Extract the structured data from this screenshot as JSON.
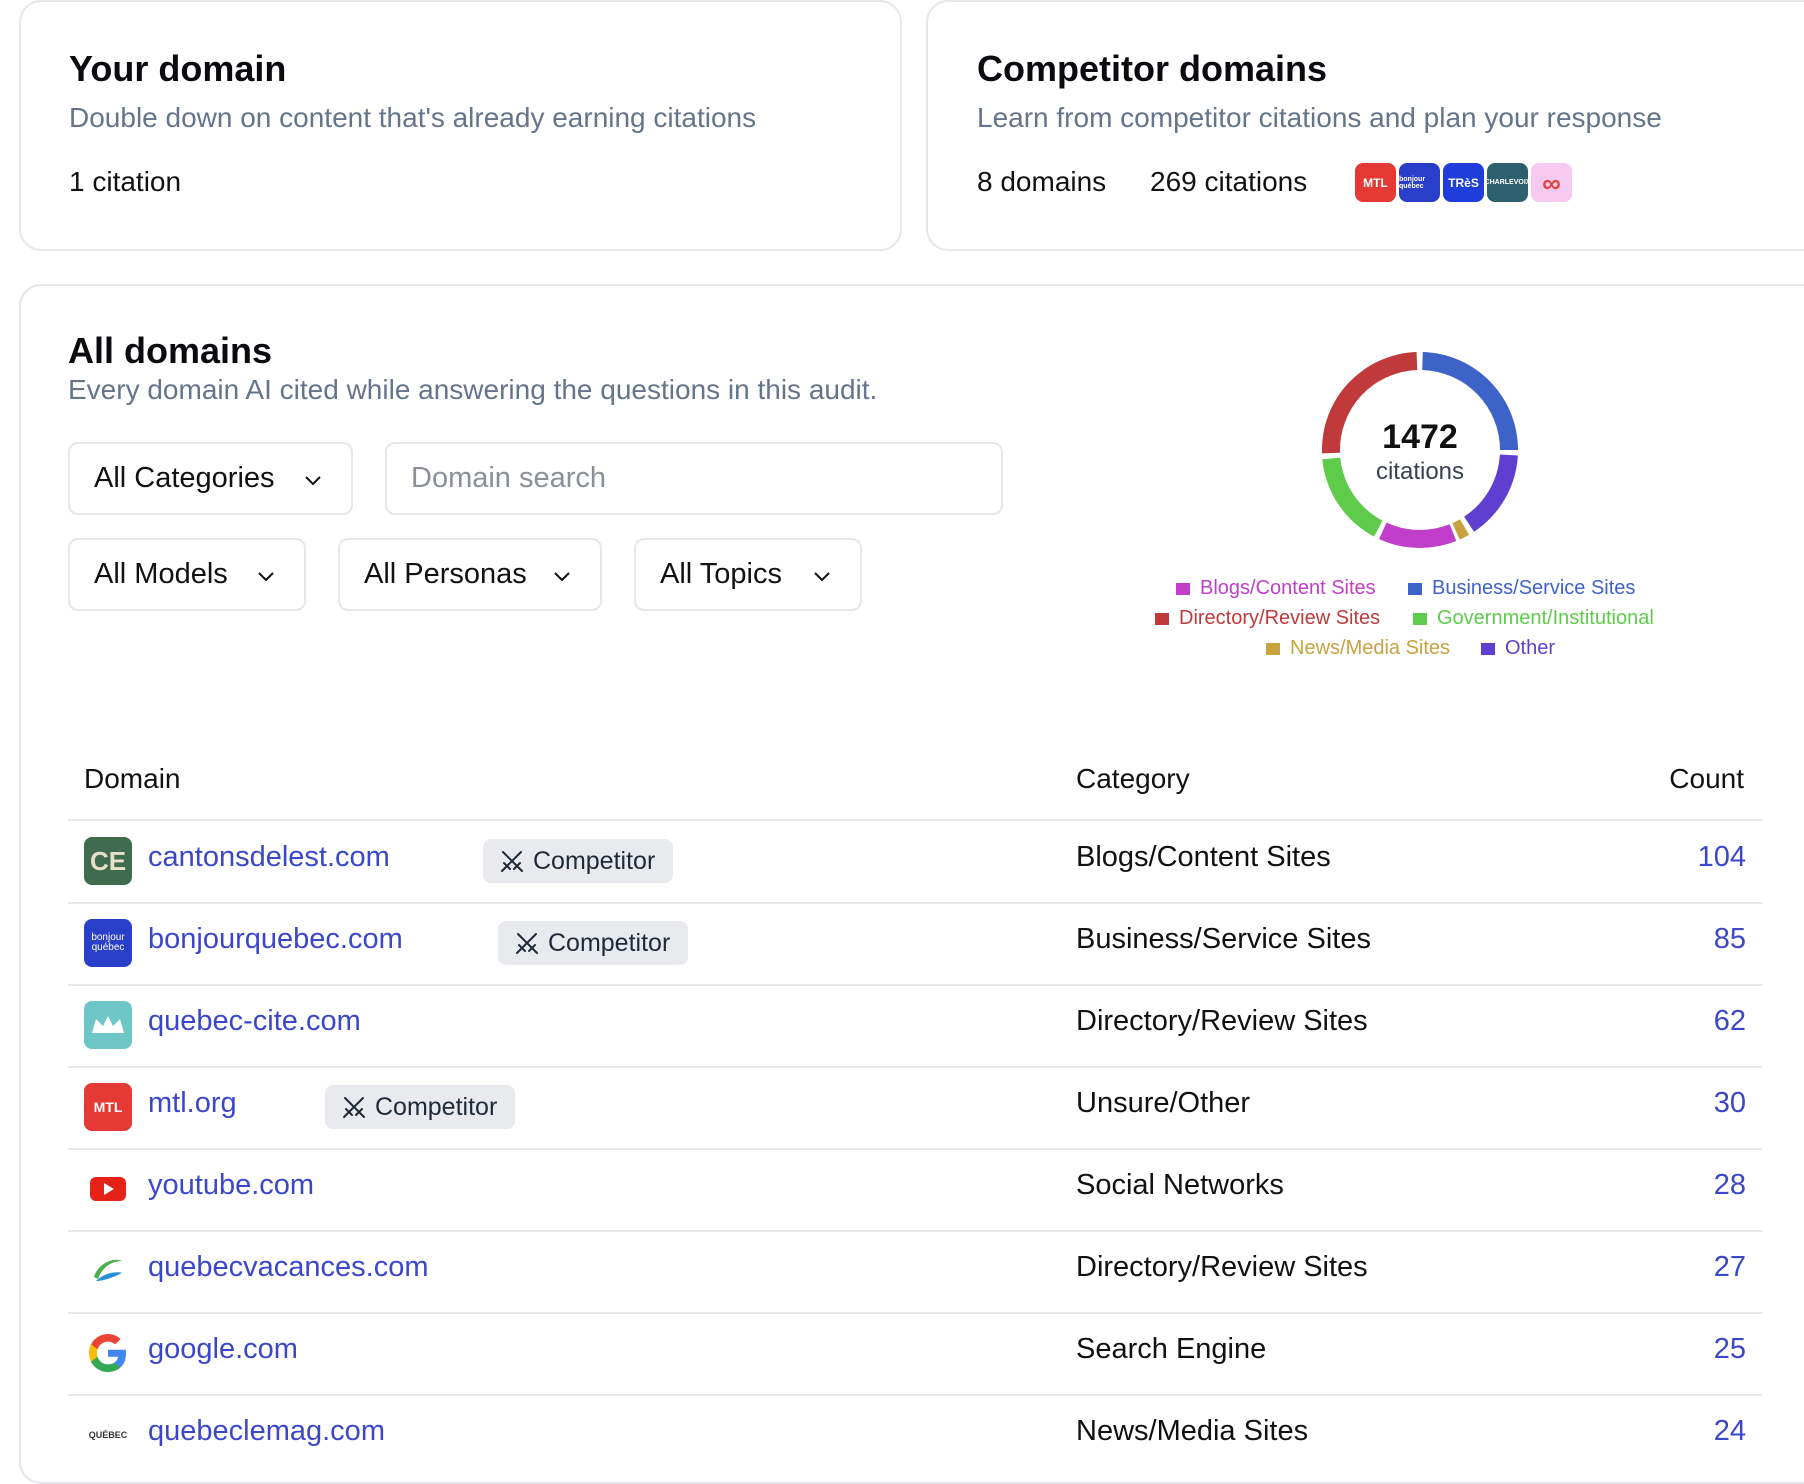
{
  "your_domain": {
    "title": "Your domain",
    "subtitle": "Double down on content that's already earning citations",
    "citations": "1 citation"
  },
  "competitor_domains": {
    "title": "Competitor domains",
    "subtitle": "Learn from competitor citations and plan your response",
    "domains": "8 domains",
    "citations": "269 citations",
    "logos": [
      {
        "name": "mtl-logo",
        "text": "MTL",
        "bg": "#e53935",
        "fg": "#ffffff"
      },
      {
        "name": "bonjour-quebec-logo",
        "text": "bonjour québec",
        "bg": "#2a3fc9",
        "fg": "#ffffff"
      },
      {
        "name": "tres-logo",
        "text": "TRèS",
        "bg": "#1f3ddb",
        "fg": "#ffffff"
      },
      {
        "name": "charlevoix-logo",
        "text": "CHARLEVOIX",
        "bg": "#2e5f6e",
        "fg": "#ffffff"
      },
      {
        "name": "infinity-logo",
        "text": "∞",
        "bg": "#f6c9f0",
        "fg": "#e0443a"
      }
    ]
  },
  "all_domains": {
    "title": "All domains",
    "subtitle": "Every domain AI cited while answering the questions in this audit.",
    "filters": {
      "categories": "All Categories",
      "search_placeholder": "Domain search",
      "models": "All Models",
      "personas": "All Personas",
      "topics": "All Topics"
    },
    "donut": {
      "total": "1472",
      "label": "citations"
    },
    "legend": [
      {
        "label": "Blogs/Content Sites",
        "color": "#c03ec9"
      },
      {
        "label": "Business/Service Sites",
        "color": "#3d63c9"
      },
      {
        "label": "Directory/Review Sites",
        "color": "#c0393b"
      },
      {
        "label": "Government/Institutional",
        "color": "#5fcb4b"
      },
      {
        "label": "News/Media Sites",
        "color": "#c9a23f"
      },
      {
        "label": "Other",
        "color": "#5e3fcf"
      }
    ],
    "table": {
      "headers": {
        "domain": "Domain",
        "category": "Category",
        "count": "Count"
      },
      "competitor_label": "Competitor",
      "rows": [
        {
          "domain": "cantonsdelest.com",
          "competitor": true,
          "category": "Blogs/Content Sites",
          "count": "104",
          "icon": "ce-icon",
          "icon_text": "CE"
        },
        {
          "domain": "bonjourquebec.com",
          "competitor": true,
          "category": "Business/Service Sites",
          "count": "85",
          "icon": "bonjour-quebec-icon",
          "icon_text": "bonjour québec"
        },
        {
          "domain": "quebec-cite.com",
          "competitor": false,
          "category": "Directory/Review Sites",
          "count": "62",
          "icon": "quebec-cite-icon",
          "icon_text": ""
        },
        {
          "domain": "mtl.org",
          "competitor": true,
          "category": "Unsure/Other",
          "count": "30",
          "icon": "mtl-icon",
          "icon_text": "MTL"
        },
        {
          "domain": "youtube.com",
          "competitor": false,
          "category": "Social Networks",
          "count": "28",
          "icon": "youtube-icon",
          "icon_text": ""
        },
        {
          "domain": "quebecvacances.com",
          "competitor": false,
          "category": "Directory/Review Sites",
          "count": "27",
          "icon": "quebecvacances-icon",
          "icon_text": ""
        },
        {
          "domain": "google.com",
          "competitor": false,
          "category": "Search Engine",
          "count": "25",
          "icon": "google-icon",
          "icon_text": ""
        },
        {
          "domain": "quebeclemag.com",
          "competitor": false,
          "category": "News/Media Sites",
          "count": "24",
          "icon": "quebeclemag-icon",
          "icon_text": "QUÉBEC"
        }
      ]
    }
  }
}
